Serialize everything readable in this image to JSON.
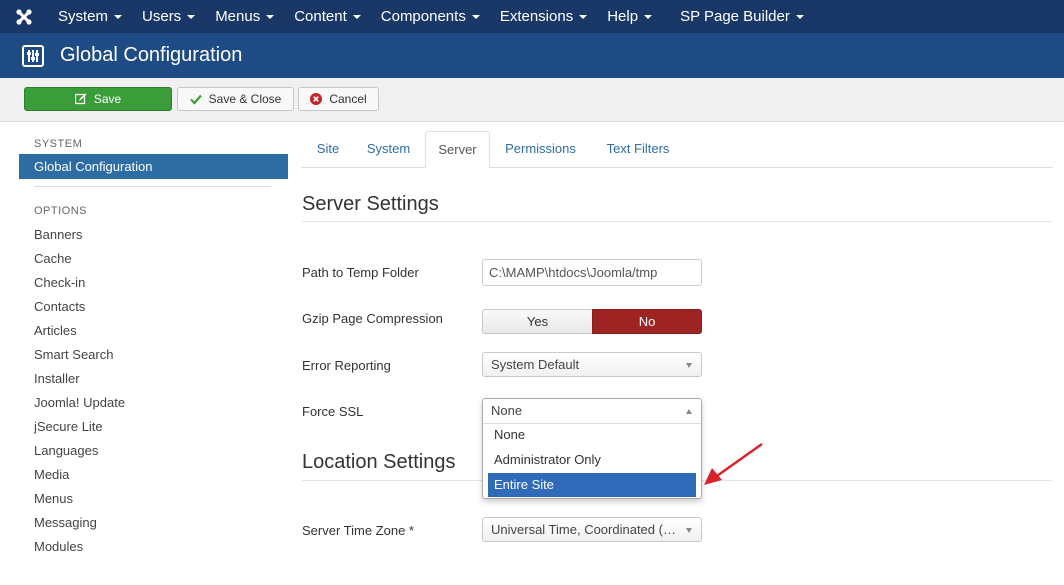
{
  "navbar": {
    "items": [
      {
        "label": "System"
      },
      {
        "label": "Users"
      },
      {
        "label": "Menus"
      },
      {
        "label": "Content"
      },
      {
        "label": "Components"
      },
      {
        "label": "Extensions"
      },
      {
        "label": "Help"
      }
    ],
    "sp_label": "SP Page Builder"
  },
  "header": {
    "title": "Global Configuration"
  },
  "toolbar": {
    "save_label": "Save",
    "save_close_label": "Save & Close",
    "cancel_label": "Cancel"
  },
  "sidebar": {
    "system_heading": "SYSTEM",
    "active_label": "Global Configuration",
    "options_heading": "OPTIONS",
    "items": [
      "Banners",
      "Cache",
      "Check-in",
      "Contacts",
      "Articles",
      "Smart Search",
      "Installer",
      "Joomla! Update",
      "jSecure Lite",
      "Languages",
      "Media",
      "Menus",
      "Messaging",
      "Modules"
    ]
  },
  "tabs": [
    "Site",
    "System",
    "Server",
    "Permissions",
    "Text Filters"
  ],
  "active_tab": "Server",
  "server_settings": {
    "title": "Server Settings",
    "temp_folder_label": "Path to Temp Folder",
    "temp_folder_value": "C:\\MAMP\\htdocs\\Joomla/tmp",
    "gzip_label": "Gzip Page Compression",
    "gzip_yes": "Yes",
    "gzip_no": "No",
    "gzip_value": "No",
    "error_reporting_label": "Error Reporting",
    "error_reporting_value": "System Default",
    "force_ssl_label": "Force SSL",
    "force_ssl_value": "None",
    "force_ssl_options": [
      "None",
      "Administrator Only",
      "Entire Site"
    ],
    "force_ssl_highlighted": "Entire Site"
  },
  "location_settings": {
    "title": "Location Settings",
    "timezone_label": "Server Time Zone *",
    "timezone_value": "Universal Time, Coordinated (UTC)"
  },
  "colors": {
    "navbar": "#1a3867",
    "header": "#1f4b85",
    "save_green": "#3b9c3a",
    "no_red": "#9e2424",
    "highlight_blue": "#2f6bb8",
    "annotation_arrow": "#d9232a"
  }
}
